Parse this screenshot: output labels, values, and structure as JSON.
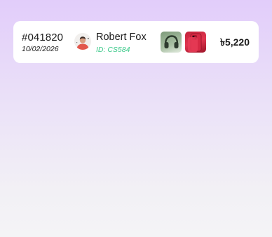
{
  "order": {
    "id": "#041820",
    "date": "10/02/2026",
    "total": "৳5,220"
  },
  "customer": {
    "name": "Robert Fox",
    "id_label": "ID: CS584"
  },
  "products": [
    {
      "icon": "headphones-product-icon"
    },
    {
      "icon": "phone-product-icon"
    }
  ],
  "colors": {
    "accent_green": "#3cc98a",
    "background_top": "#e2cdfa",
    "background_bottom": "#f4f4f6"
  }
}
